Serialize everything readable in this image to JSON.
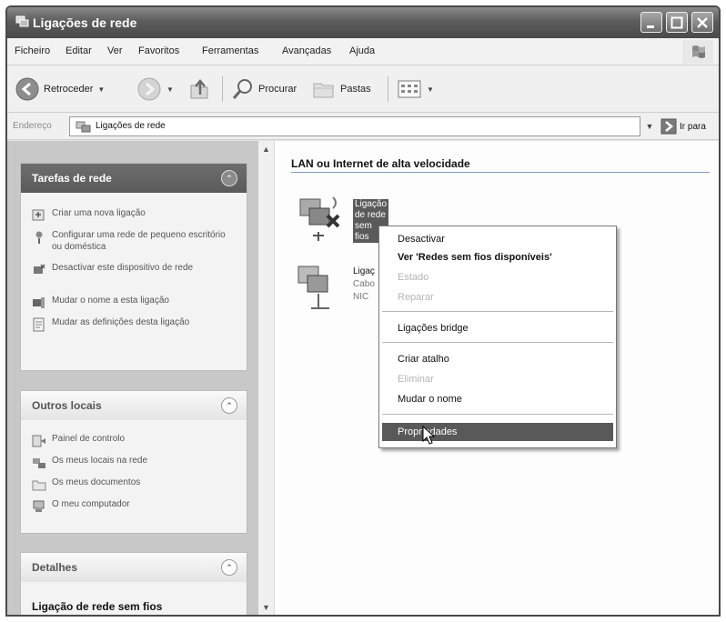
{
  "window": {
    "title": "Ligações de rede",
    "title_icon": "network-connections-icon"
  },
  "menu": {
    "items": [
      "Ficheiro",
      "Editar",
      "Ver",
      "Favoritos",
      "Ferramentas",
      "Avançadas",
      "Ajuda"
    ]
  },
  "toolbar": {
    "back_label": "Retroceder",
    "search_label": "Procurar",
    "folders_label": "Pastas"
  },
  "address": {
    "label": "Endereço",
    "value": "Ligações de rede",
    "go_label": "Ir para"
  },
  "network_tasks": {
    "title": "Tarefas de rede",
    "items": [
      "Criar uma nova ligação",
      "Configurar uma rede de pequeno escritório ou doméstica",
      "Desactivar este dispositivo de rede",
      "Mudar o nome a esta ligação",
      "Mudar as definições desta ligação"
    ]
  },
  "other_places": {
    "title": "Outros locais",
    "items": [
      "Painel de controlo",
      "Os meus locais na rede",
      "Os meus documentos",
      "O meu computador"
    ]
  },
  "details": {
    "title": "Detalhes",
    "selected_name": "Ligação de rede sem fios"
  },
  "content": {
    "group_header": "LAN ou Internet de alta velocidade",
    "connection_1": {
      "name": "Ligação de rede sem fios"
    },
    "connection_2": {
      "name_partial": "Ligaç",
      "status_partial": "Cabo",
      "device_partial": "NIC"
    }
  },
  "context_menu": {
    "deactivate": "Desactivar",
    "view_wireless": "Ver 'Redes sem fios disponíveis'",
    "status": "Estado",
    "repair": "Reparar",
    "bridge": "Ligações bridge",
    "shortcut": "Criar atalho",
    "delete": "Eliminar",
    "rename": "Mudar o nome",
    "properties": "Propriedades"
  },
  "colors": {
    "titlebar": "#5c5c5c",
    "menu_highlight": "#595959",
    "group_line": "#7f9bc4"
  }
}
